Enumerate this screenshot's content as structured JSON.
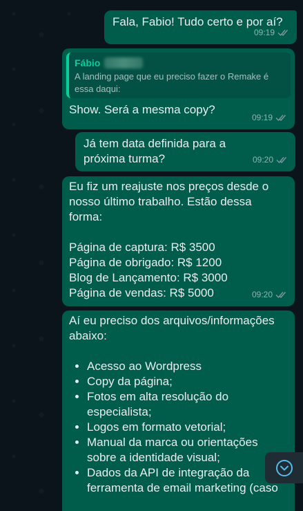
{
  "messages": [
    {
      "text": "Fala, Fabio! Tudo certo e por aí?",
      "time": "09:19"
    },
    {
      "quote_author": "Fábio",
      "quote_text": "A landing page que eu preciso fazer o Remake é essa daqui:",
      "text": "Show. Será a mesma copy?",
      "time": "09:19"
    },
    {
      "text": "Já tem data definida para a próxima turma?",
      "time": "09:20"
    },
    {
      "intro": "Eu fiz um reajuste nos preços desde o nosso último trabalho. Estão dessa forma:",
      "prices": [
        "Página de captura: R$ 3500",
        "Página de obrigado: R$ 1200",
        "Blog de Lançamento: R$ 3000",
        "Página de vendas: R$ 5000"
      ],
      "time": "09:20"
    },
    {
      "intro": "Aí eu preciso dos arquivos/informações abaixo:",
      "items": [
        "Acesso ao Wordpress",
        "Copy da página;",
        "Fotos em alta resolução do especialista;",
        "Logos em formato vetorial;",
        "Manual da marca ou orientações sobre a identidade visual;",
        "Dados da API de integração da ferramenta de email marketing (caso"
      ]
    }
  ],
  "colors": {
    "bubble_outgoing": "#005c4b",
    "background": "#0b141a",
    "quote_accent": "#06cf9c",
    "read_tick": "#8696a0",
    "scroll_button_accent": "#53bdeb"
  },
  "icons": {
    "tick": "double-check-icon",
    "scroll": "chevron-down-icon"
  }
}
